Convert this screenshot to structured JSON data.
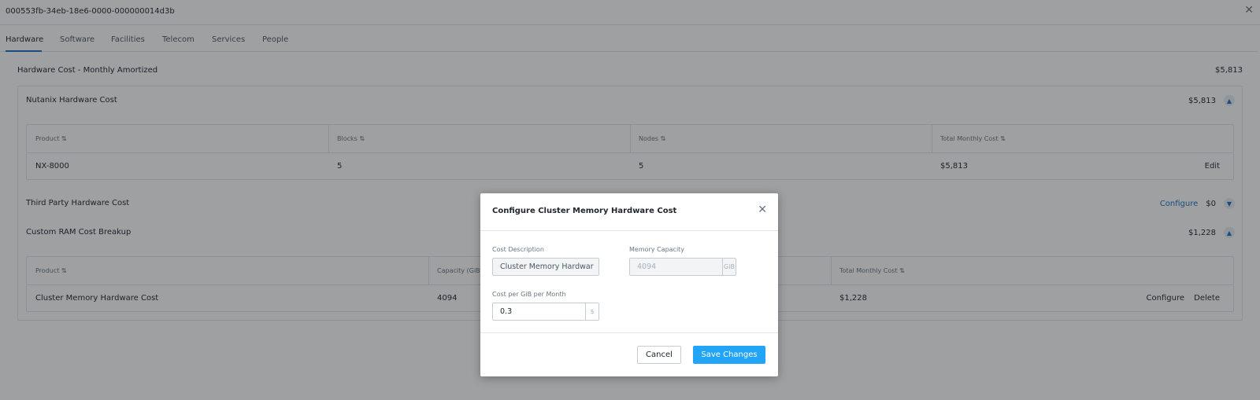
{
  "window": {
    "title": "000553fb-34eb-18e6-0000-000000014d3b"
  },
  "tabs": [
    {
      "label": "Hardware"
    },
    {
      "label": "Software"
    },
    {
      "label": "Facilities"
    },
    {
      "label": "Telecom"
    },
    {
      "label": "Services"
    },
    {
      "label": "People"
    }
  ],
  "summary": {
    "label": "Hardware Cost - Monthly Amortized",
    "value": "$5,813"
  },
  "nutanix": {
    "label": "Nutanix Hardware Cost",
    "value": "$5,813",
    "columns": [
      "Product",
      "Blocks",
      "Nodes",
      "Total Monthly Cost"
    ],
    "row": {
      "product": "NX-8000",
      "blocks": "5",
      "nodes": "5",
      "total": "$5,813",
      "action": "Edit"
    }
  },
  "third_party": {
    "label": "Third Party Hardware Cost",
    "configure": "Configure",
    "value": "$0"
  },
  "custom_ram": {
    "label": "Custom RAM Cost Breakup",
    "value": "$1,228",
    "columns": [
      "Product",
      "Capacity (GiB",
      "Total Monthly Cost"
    ],
    "row": {
      "product": "Cluster Memory Hardware Cost",
      "capacity": "4094",
      "total": "$1,228",
      "configure": "Configure",
      "delete": "Delete"
    }
  },
  "modal": {
    "title": "Configure Cluster Memory Hardware Cost",
    "cost_description_label": "Cost Description",
    "cost_description_value": "Cluster Memory Hardwar",
    "memory_capacity_label": "Memory Capacity",
    "memory_capacity_value": "4094",
    "memory_capacity_unit": "GiB",
    "cost_per_gib_label": "Cost per GiB per Month",
    "cost_per_gib_value": "0.3",
    "cost_per_gib_unit": "$",
    "cancel_label": "Cancel",
    "save_label": "Save Changes"
  },
  "colors": {
    "accent": "#22a5f7",
    "link": "#1b6dc1",
    "overlay": "#191d22"
  }
}
